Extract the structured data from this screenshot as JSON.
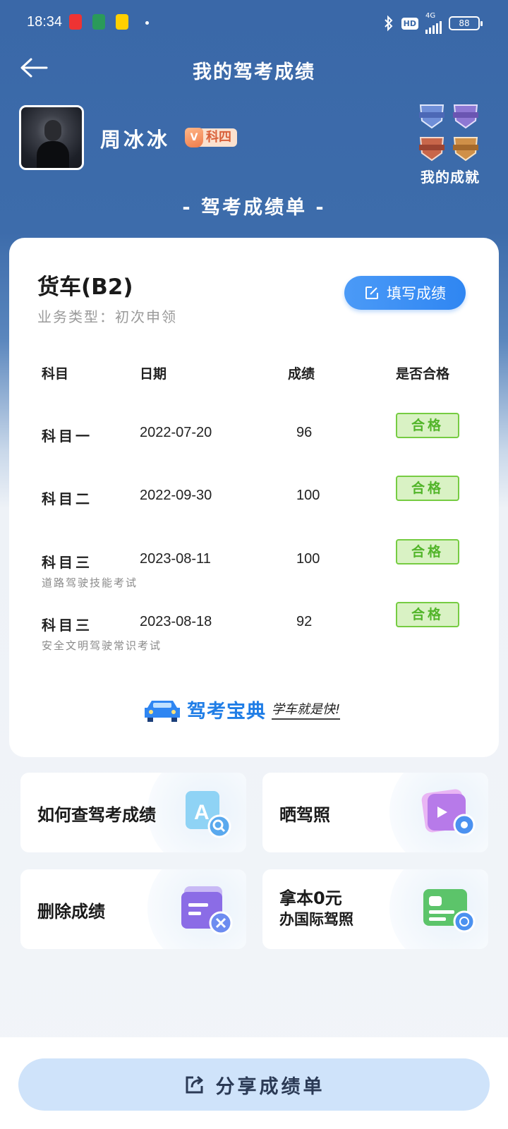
{
  "status_bar": {
    "time": "18:34",
    "hd": "HD",
    "network": "4G",
    "battery": "88"
  },
  "header": {
    "title": "我的驾考成绩"
  },
  "profile": {
    "name": "周冰冰",
    "badge_v": "V",
    "level": "科四"
  },
  "achievements": {
    "label": "我的成就"
  },
  "report": {
    "title": "- 驾考成绩单 -"
  },
  "card": {
    "vehicle": "货车(B2)",
    "business": "业务类型：初次申领",
    "fill_button": "填写成绩",
    "columns": [
      "科目",
      "日期",
      "成绩",
      "是否合格"
    ],
    "rows": [
      {
        "subject": "科目一",
        "sub": "",
        "date": "2022-07-20",
        "score": "96",
        "status": "合格"
      },
      {
        "subject": "科目二",
        "sub": "",
        "date": "2022-09-30",
        "score": "100",
        "status": "合格"
      },
      {
        "subject": "科目三",
        "sub": "道路驾驶技能考试",
        "date": "2023-08-11",
        "score": "100",
        "status": "合格"
      },
      {
        "subject": "科目三",
        "sub": "安全文明驾驶常识考试",
        "date": "2023-08-18",
        "score": "92",
        "status": "合格"
      }
    ],
    "brand_name": "驾考宝典",
    "brand_slogan": "学车就是快!"
  },
  "tiles": {
    "query": "如何查驾考成绩",
    "show": "晒驾照",
    "delete": "删除成绩",
    "intl_line1": "拿本0元",
    "intl_line2": "办国际驾照"
  },
  "share": {
    "label": "分享成绩单"
  },
  "colors": {
    "primary": "#3a68a8",
    "accent": "#2f86f2",
    "pass": "#52b52a"
  }
}
